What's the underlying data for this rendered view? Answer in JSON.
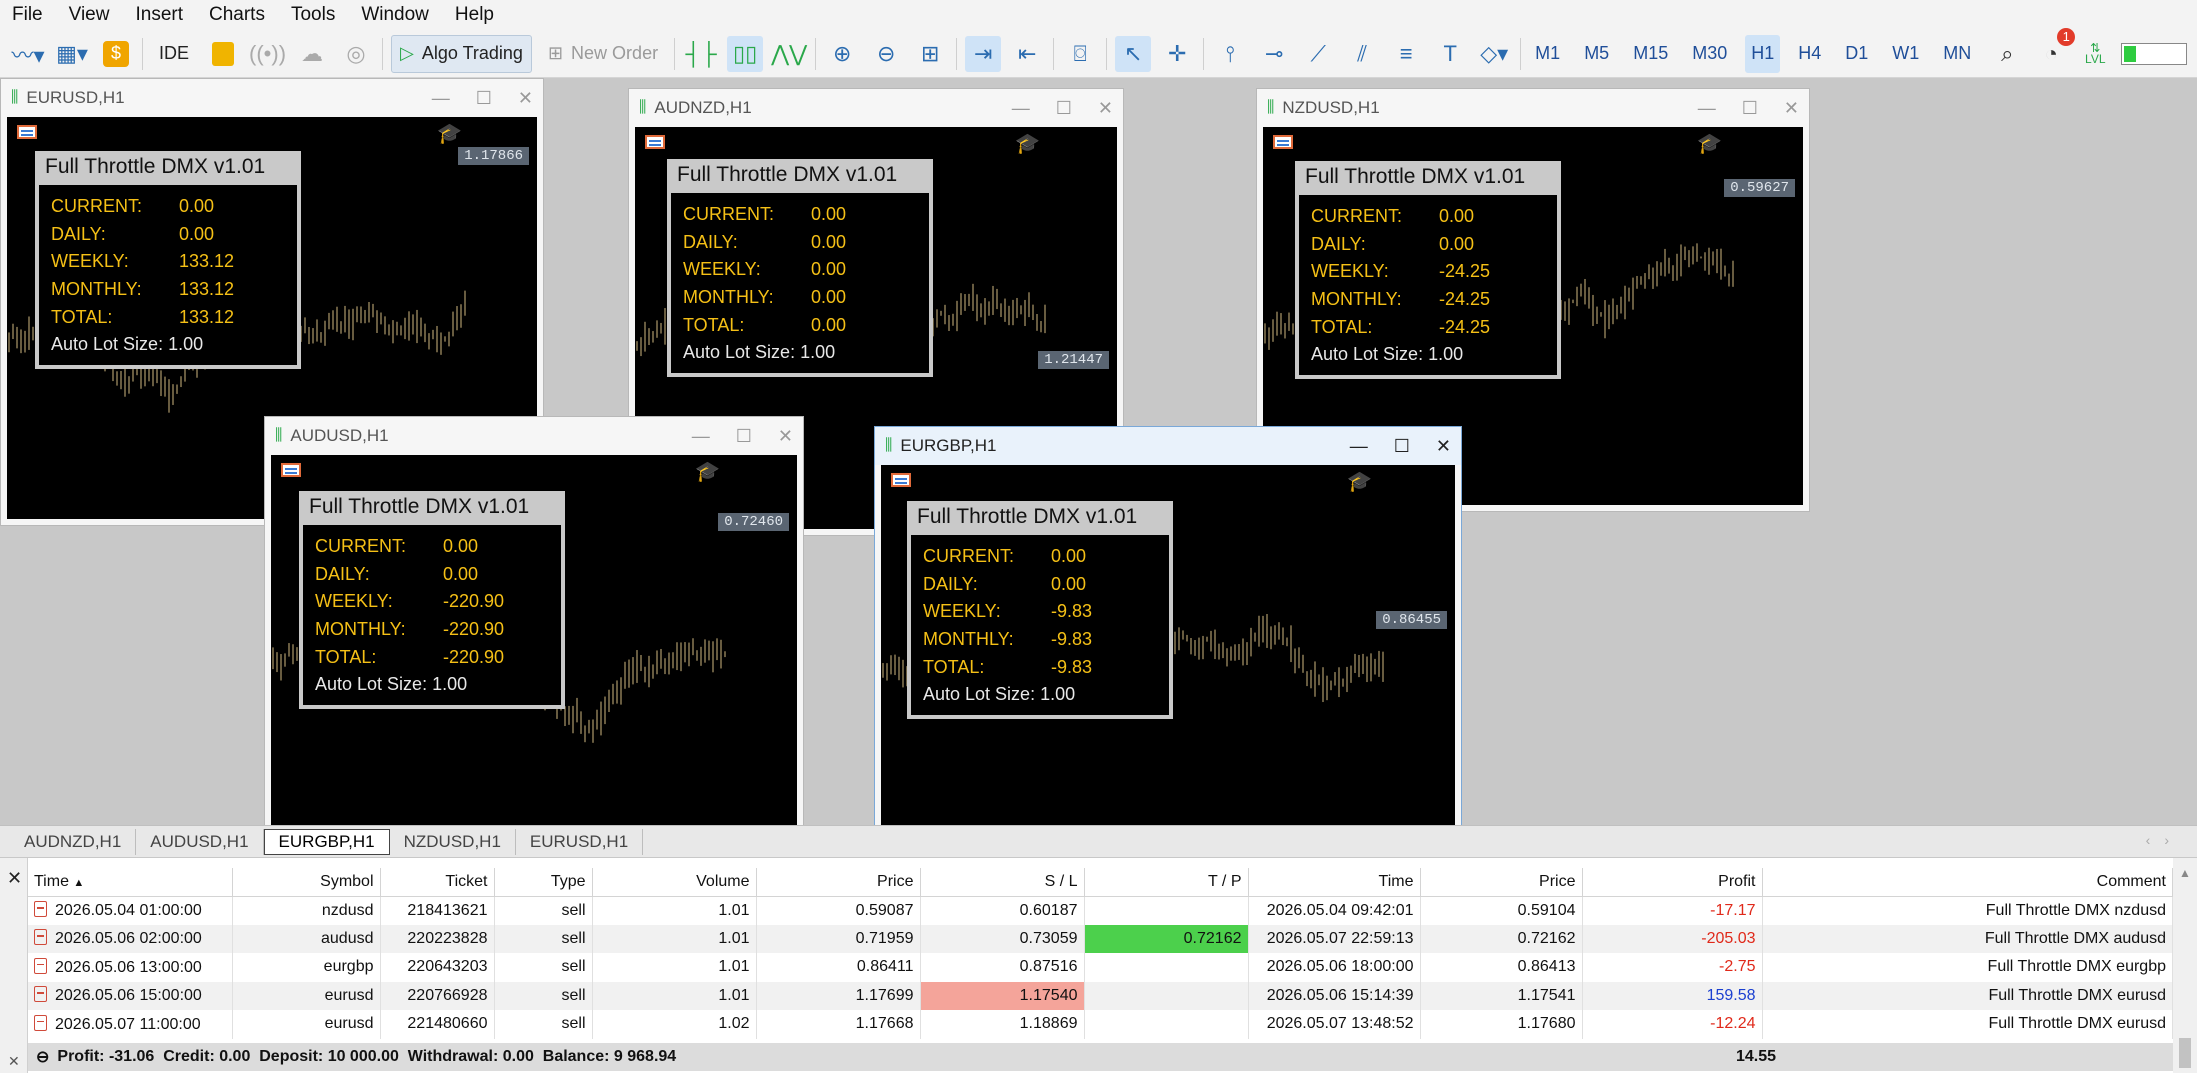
{
  "menu": [
    "File",
    "View",
    "Insert",
    "Charts",
    "Tools",
    "Window",
    "Help"
  ],
  "toolbar": {
    "ide": "IDE",
    "algo_trading": "Algo Trading",
    "new_order": "New Order",
    "timeframes": [
      "M1",
      "M5",
      "M15",
      "M30",
      "H1",
      "H4",
      "D1",
      "W1",
      "MN"
    ],
    "active_timeframe": "H1",
    "notification_count": "1",
    "level_label": "LVL"
  },
  "windows": [
    {
      "title": "EURUSD,H1",
      "price": "1.17866",
      "panel": {
        "title": "Full Throttle DMX v1.01",
        "current": "0.00",
        "daily": "0.00",
        "weekly": "133.12",
        "monthly": "133.12",
        "total": "133.12",
        "auto_lot": "Auto Lot Size: 1.00"
      }
    },
    {
      "title": "AUDNZD,H1",
      "price": "1.21447",
      "panel": {
        "title": "Full Throttle DMX v1.01",
        "current": "0.00",
        "daily": "0.00",
        "weekly": "0.00",
        "monthly": "0.00",
        "total": "0.00",
        "auto_lot": "Auto Lot Size: 1.00"
      }
    },
    {
      "title": "NZDUSD,H1",
      "price": "0.59627",
      "panel": {
        "title": "Full Throttle DMX v1.01",
        "current": "0.00",
        "daily": "0.00",
        "weekly": "-24.25",
        "monthly": "-24.25",
        "total": "-24.25",
        "auto_lot": "Auto Lot Size: 1.00"
      }
    },
    {
      "title": "AUDUSD,H1",
      "price": "0.72460",
      "panel": {
        "title": "Full Throttle DMX v1.01",
        "current": "0.00",
        "daily": "0.00",
        "weekly": "-220.90",
        "monthly": "-220.90",
        "total": "-220.90",
        "auto_lot": "Auto Lot Size: 1.00"
      }
    },
    {
      "title": "EURGBP,H1",
      "price": "0.86455",
      "panel": {
        "title": "Full Throttle DMX v1.01",
        "current": "0.00",
        "daily": "0.00",
        "weekly": "-9.83",
        "monthly": "-9.83",
        "total": "-9.83",
        "auto_lot": "Auto Lot Size: 1.00"
      }
    }
  ],
  "labels": {
    "current": "CURRENT:",
    "daily": "DAILY:",
    "weekly": "WEEKLY:",
    "monthly": "MONTHLY:",
    "total": "TOTAL:"
  },
  "chart_tabs": [
    "AUDNZD,H1",
    "AUDUSD,H1",
    "EURGBP,H1",
    "NZDUSD,H1",
    "EURUSD,H1"
  ],
  "active_chart_tab": "EURGBP,H1",
  "table": {
    "headers": [
      "Time",
      "Symbol",
      "Ticket",
      "Type",
      "Volume",
      "Price",
      "S / L",
      "T / P",
      "Time",
      "Price",
      "Profit",
      "Comment"
    ],
    "rows": [
      [
        "2026.05.04 01:00:00",
        "nzdusd",
        "218413621",
        "sell",
        "1.01",
        "0.59087",
        "0.60187",
        "",
        "2026.05.04 09:42:01",
        "0.59104",
        "-17.17",
        "Full Throttle DMX nzdusd"
      ],
      [
        "2026.05.06 02:00:00",
        "audusd",
        "220223828",
        "sell",
        "1.01",
        "0.71959",
        "0.73059",
        "0.72162",
        "2026.05.07 22:59:13",
        "0.72162",
        "-205.03",
        "Full Throttle DMX audusd"
      ],
      [
        "2026.05.06 13:00:00",
        "eurgbp",
        "220643203",
        "sell",
        "1.01",
        "0.86411",
        "0.87516",
        "",
        "2026.05.06 18:00:00",
        "0.86413",
        "-2.75",
        "Full Throttle DMX eurgbp"
      ],
      [
        "2026.05.06 15:00:00",
        "eurusd",
        "220766928",
        "sell",
        "1.01",
        "1.17699",
        "1.17540",
        "",
        "2026.05.06 15:14:39",
        "1.17541",
        "159.58",
        "Full Throttle DMX eurusd"
      ],
      [
        "2026.05.07 11:00:00",
        "eurusd",
        "221480660",
        "sell",
        "1.02",
        "1.17668",
        "1.18869",
        "",
        "2026.05.07 13:48:52",
        "1.17680",
        "-12.24",
        "Full Throttle DMX eurusd"
      ]
    ]
  },
  "summary": {
    "text": "Profit: -31.06  Credit: 0.00  Deposit: 10 000.00  Withdrawal: 0.00  Balance: 9 968.94",
    "total": "14.55"
  },
  "colors": {
    "panel_value": "#f5c016",
    "loss": "#e0291a",
    "gain": "#1a3fd0",
    "tp_highlight": "#4cd04c",
    "sl_highlight": "#f4a49a"
  }
}
